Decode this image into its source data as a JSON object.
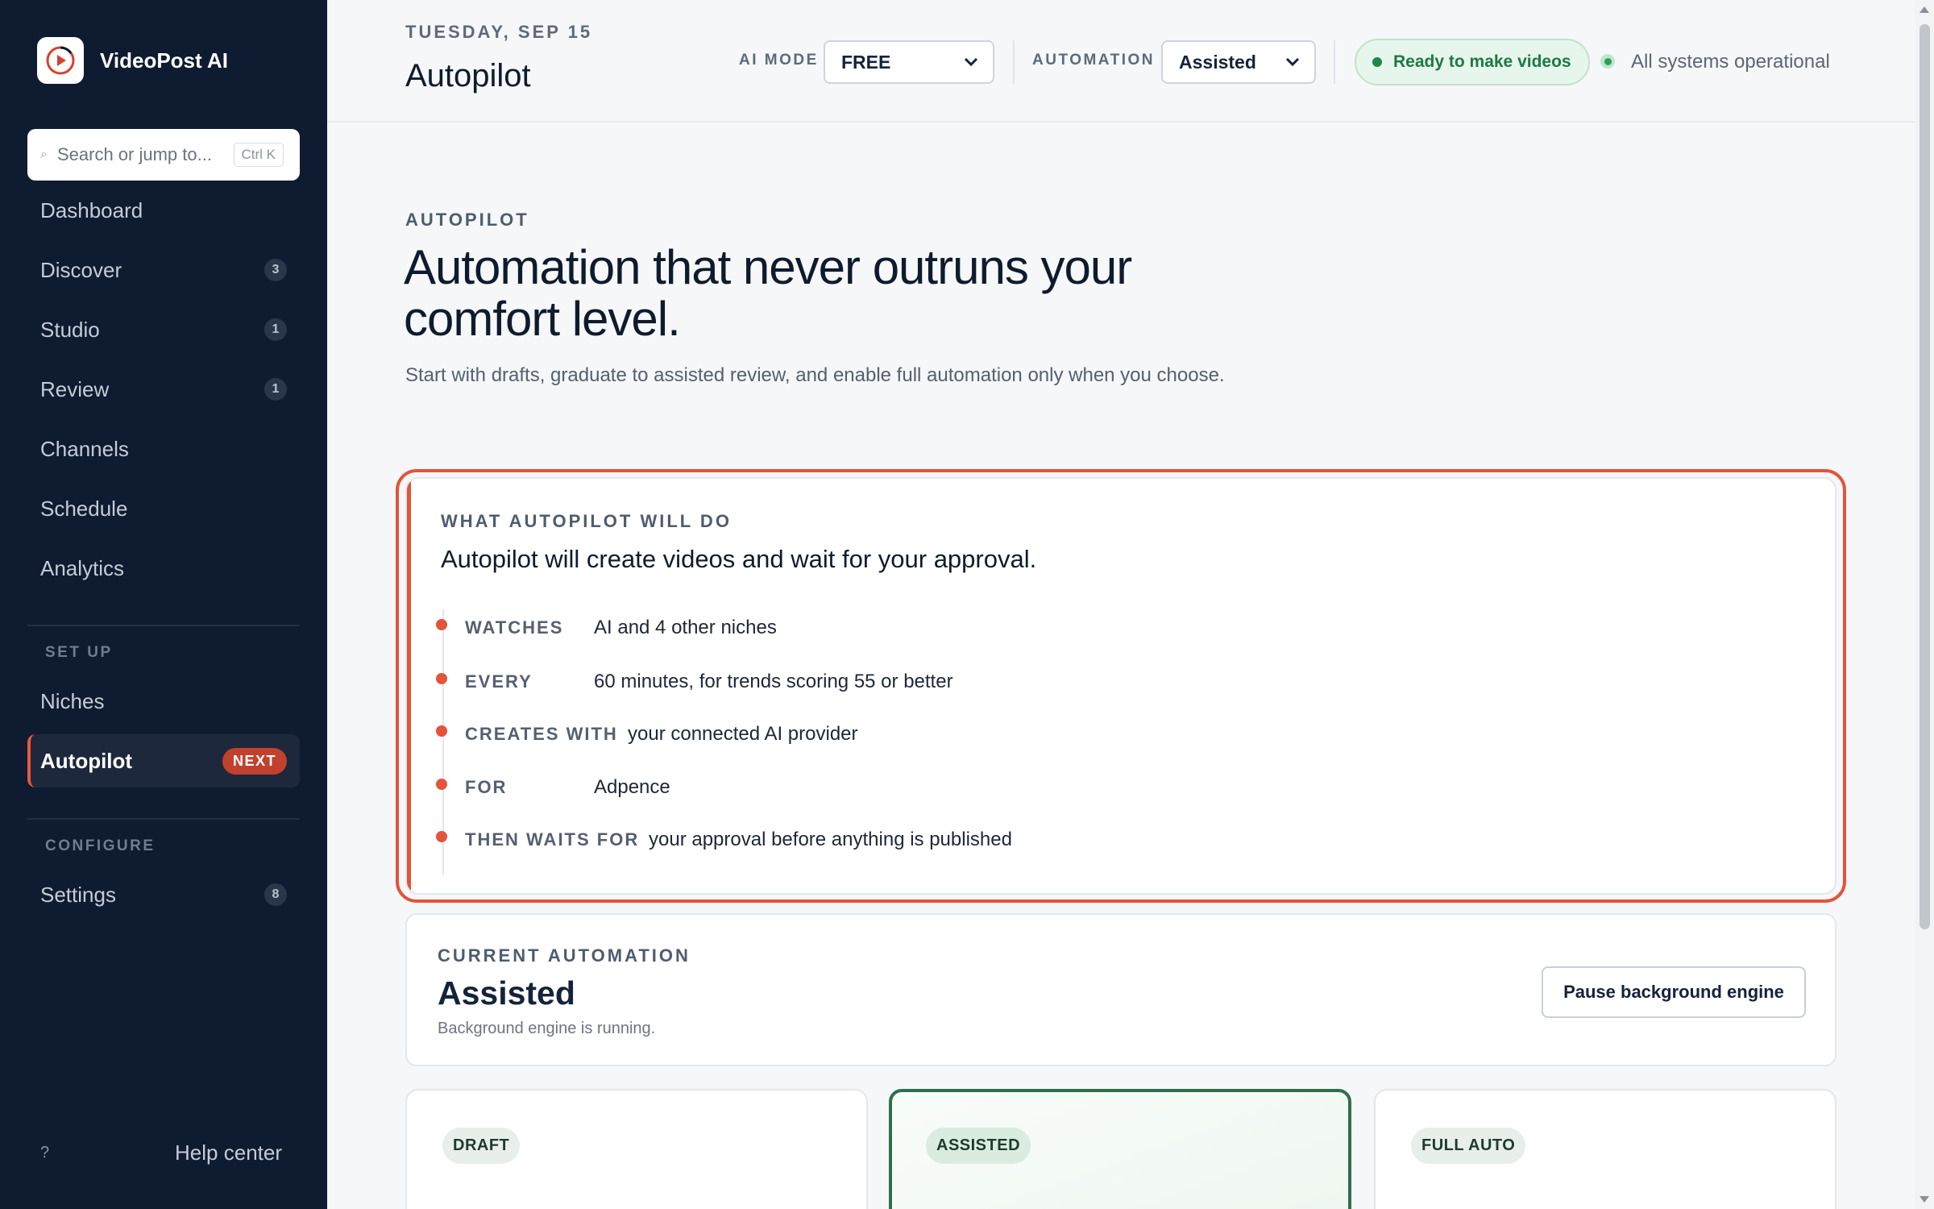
{
  "app": {
    "name": "VideoPost AI"
  },
  "search": {
    "placeholder": "Search or jump to...",
    "shortcut": "Ctrl K"
  },
  "sidebar": {
    "items": [
      {
        "label": "Dashboard",
        "badge": ""
      },
      {
        "label": "Discover",
        "badge": "3"
      },
      {
        "label": "Studio",
        "badge": "1"
      },
      {
        "label": "Review",
        "badge": "1"
      },
      {
        "label": "Channels",
        "badge": ""
      },
      {
        "label": "Schedule",
        "badge": ""
      },
      {
        "label": "Analytics",
        "badge": ""
      }
    ],
    "setup_section": "SET UP",
    "setup_items": [
      {
        "label": "Niches"
      },
      {
        "label": "Autopilot",
        "pill": "NEXT",
        "active": true
      }
    ],
    "configure_section": "CONFIGURE",
    "configure_items": [
      {
        "label": "Settings",
        "badge": "8"
      }
    ],
    "help": {
      "icon_text": "?",
      "label": "Help center"
    }
  },
  "header": {
    "date": "TUESDAY, SEP 15",
    "title": "Autopilot",
    "ai_mode_label": "AI MODE",
    "ai_mode_value": "FREE",
    "automation_label": "AUTOMATION",
    "automation_value": "Assisted",
    "ready_status": "Ready to make videos",
    "system_status": "All systems operational"
  },
  "main": {
    "eyebrow": "AUTOPILOT",
    "title": "Automation that never outruns your comfort level.",
    "subtitle": "Start with drafts, graduate to assisted review, and enable full automation only when you choose.",
    "will_do": {
      "eyebrow": "WHAT AUTOPILOT WILL DO",
      "headline": "Autopilot will create videos and wait for your approval.",
      "steps": [
        {
          "key": "WATCHES",
          "value": "AI and 4 other niches"
        },
        {
          "key": "EVERY",
          "value": "60 minutes, for trends scoring 55 or better"
        },
        {
          "key": "CREATES WITH",
          "value": "your connected AI provider"
        },
        {
          "key": "FOR",
          "value": "Adpence"
        },
        {
          "key": "THEN WAITS FOR",
          "value": "your approval before anything is published"
        }
      ]
    },
    "current": {
      "eyebrow": "CURRENT AUTOMATION",
      "mode": "Assisted",
      "status": "Background engine is running.",
      "pause_button": "Pause background engine"
    },
    "modes": [
      {
        "label": "DRAFT",
        "selected": false
      },
      {
        "label": "ASSISTED",
        "selected": true
      },
      {
        "label": "FULL AUTO",
        "selected": false
      }
    ]
  },
  "colors": {
    "sidebar_bg": "#0f1b31",
    "accent": "#e5533a",
    "success": "#1d8a4a",
    "selected_border": "#2e6f4c"
  }
}
